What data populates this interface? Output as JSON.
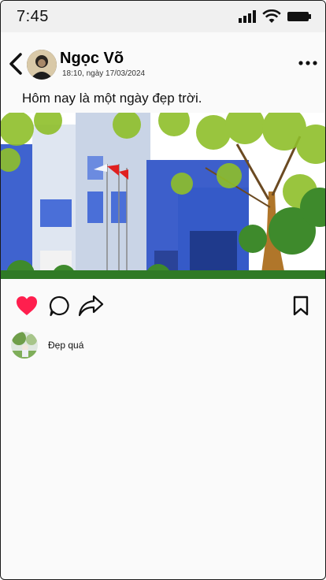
{
  "status_bar": {
    "time": "7:45"
  },
  "post": {
    "author": "Ngọc Võ",
    "timestamp": "18:10, ngày 17/03/2024",
    "caption": "Hôm nay là một ngày đẹp trời.",
    "liked": true
  },
  "icons": {
    "back": "chevron-left-icon",
    "more": "more-horizontal-icon",
    "like": "heart-icon",
    "comment": "comment-icon",
    "share": "share-icon",
    "bookmark": "bookmark-icon"
  },
  "colors": {
    "like": "#ff1f4e",
    "sky": "#ffffff",
    "building": "#4a6fd8"
  },
  "comments": [
    {
      "text": "Đẹp quá"
    }
  ]
}
